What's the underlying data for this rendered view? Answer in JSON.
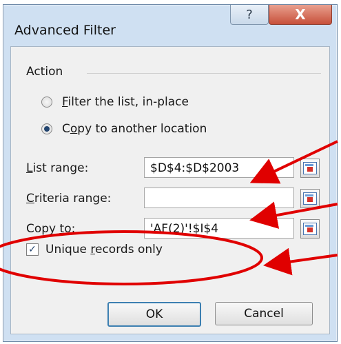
{
  "window": {
    "title": "Advanced Filter",
    "help_glyph": "?",
    "close_glyph": "X"
  },
  "action": {
    "group_label": "Action",
    "option_filter_in_place": {
      "mnemonic": "F",
      "rest": "ilter the list, in-place",
      "selected": false
    },
    "option_copy_to_location": {
      "pre": "C",
      "mnemonic": "o",
      "rest": "py to another location",
      "selected": true
    }
  },
  "fields": {
    "list_range": {
      "mnemonic": "L",
      "rest": "ist range:",
      "value": "$D$4:$D$2003"
    },
    "criteria_range": {
      "mnemonic": "C",
      "rest": "riteria range:",
      "value": ""
    },
    "copy_to": {
      "pre": "Copy ",
      "mnemonic": "t",
      "rest": "o:",
      "value": "'AF(2)'!$I$4"
    }
  },
  "unique_records": {
    "pre": "Unique ",
    "mnemonic": "r",
    "rest": "ecords only",
    "checked": true,
    "check_glyph": "✓"
  },
  "buttons": {
    "ok": "OK",
    "cancel": "Cancel"
  },
  "icons": {
    "ref_button": "collapse-dialog-icon"
  },
  "colors": {
    "annotation": "#e00000",
    "title_bar": "#cfe0f2",
    "close_button": "#c7503a"
  }
}
